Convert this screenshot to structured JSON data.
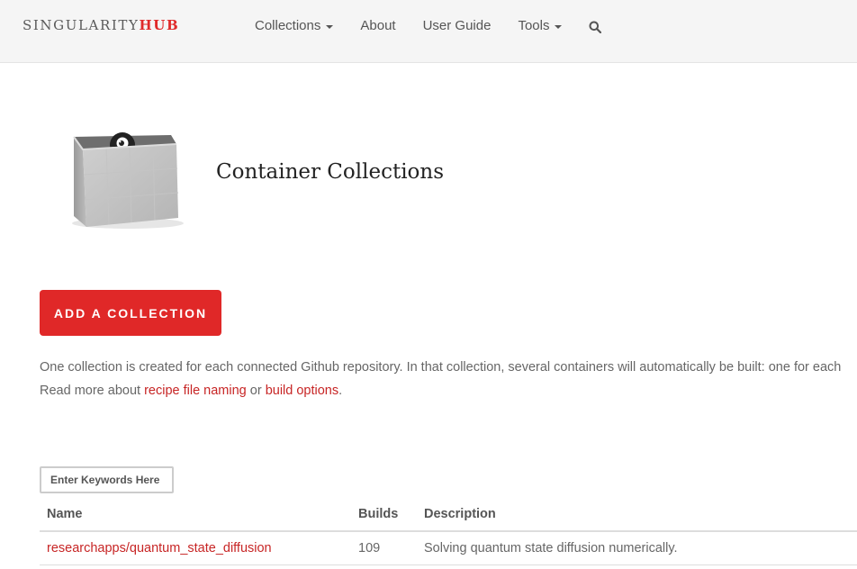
{
  "navbar": {
    "brand_main": "SINGULARITY",
    "brand_accent": "HUB",
    "items": [
      {
        "label": "Collections",
        "dropdown": true
      },
      {
        "label": "About",
        "dropdown": false
      },
      {
        "label": "User Guide",
        "dropdown": false
      },
      {
        "label": "Tools",
        "dropdown": true
      }
    ],
    "search_icon": "search-icon"
  },
  "hero": {
    "image": "container-box-icon",
    "title": "Container Collections"
  },
  "add_button": {
    "label": "ADD A COLLECTION"
  },
  "intro": {
    "line1": "One collection is created for each connected Github repository. In that collection, several containers will automatically be built: one for each",
    "line2_prefix": "Read more about ",
    "link1": "recipe file naming",
    "line2_middle": " or ",
    "link2": "build options",
    "line2_suffix": "."
  },
  "search": {
    "placeholder": "Enter Keywords Here",
    "value": ""
  },
  "table": {
    "headers": {
      "name": "Name",
      "builds": "Builds",
      "description": "Description"
    },
    "rows": [
      {
        "name": "researchapps/quantum_state_diffusion",
        "builds": "109",
        "description": "Solving quantum state diffusion numerically."
      }
    ]
  },
  "colors": {
    "accent": "#e02828",
    "link": "#c72525",
    "navbar_bg": "#f5f5f5"
  }
}
